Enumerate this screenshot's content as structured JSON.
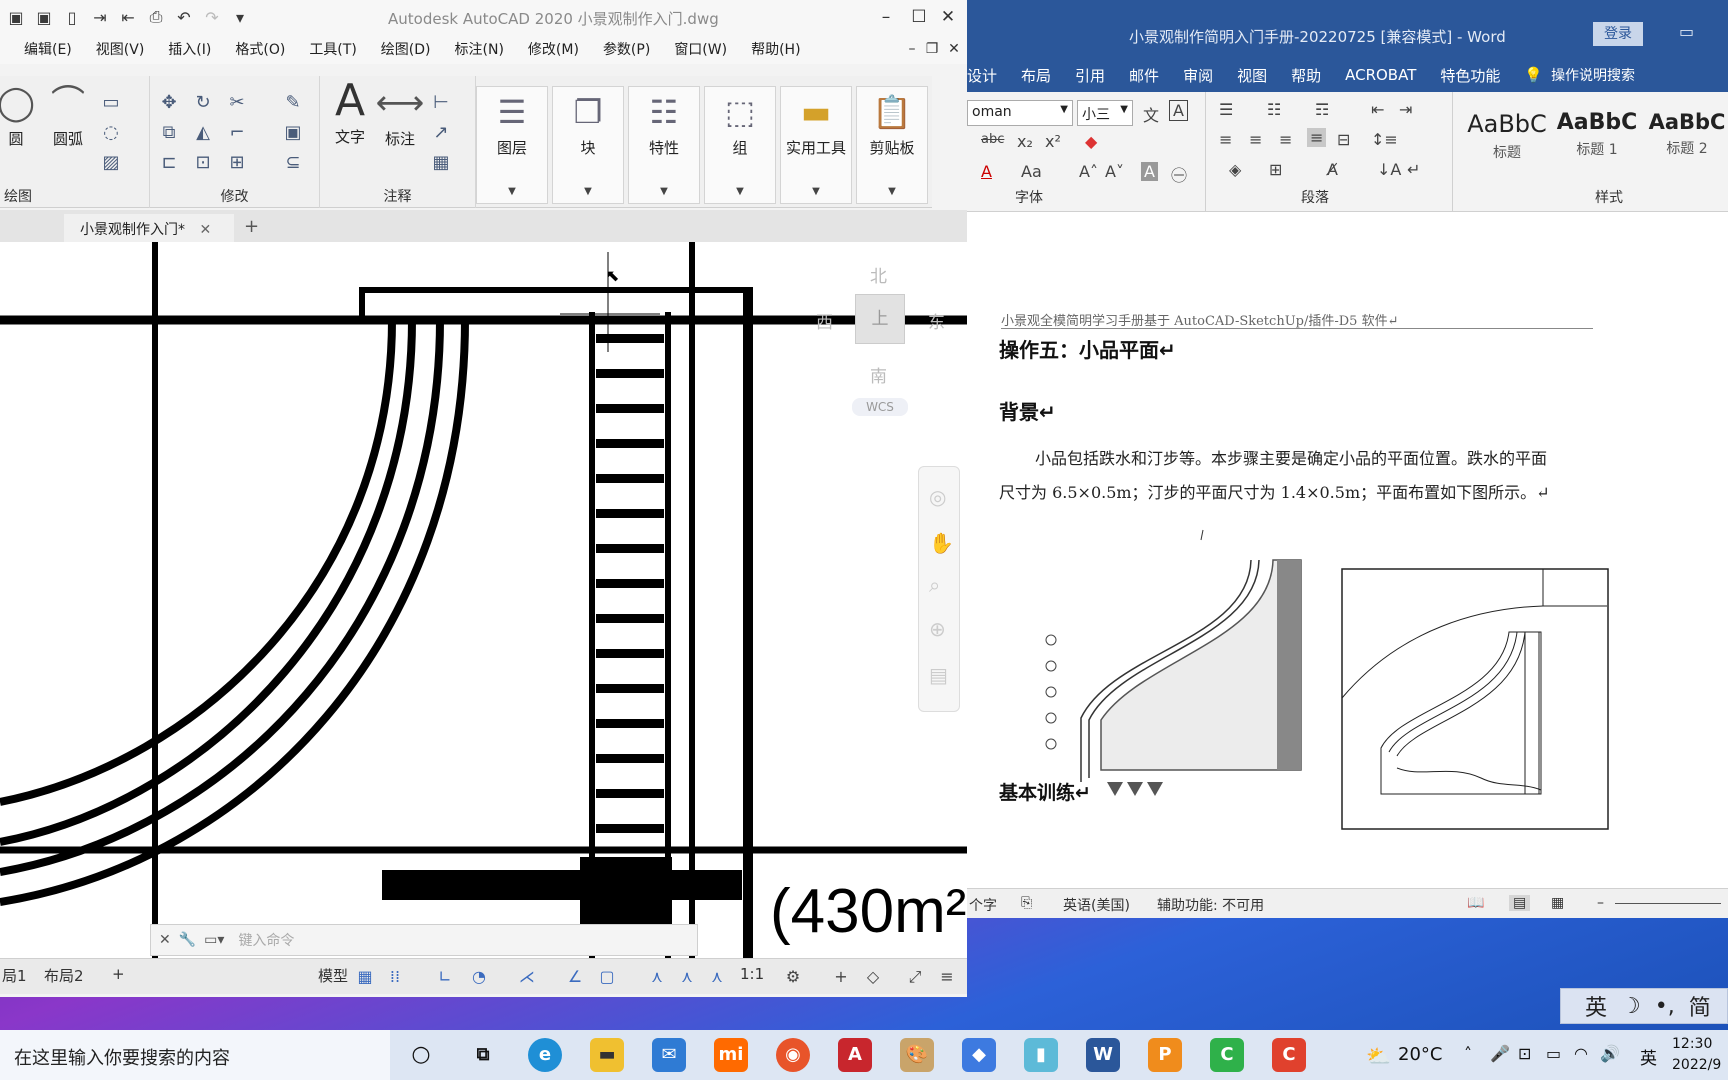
{
  "acad": {
    "title": "Autodesk AutoCAD 2020    小景观制作入门.dwg",
    "menu": [
      "编辑(E)",
      "视图(V)",
      "插入(I)",
      "格式(O)",
      "工具(T)",
      "绘图(D)",
      "标注(N)",
      "修改(M)",
      "参数(P)",
      "窗口(W)",
      "帮助(H)"
    ],
    "draw_group": {
      "circle": "圆",
      "arc": "圆弧",
      "label": "绘图"
    },
    "modify_group": {
      "label": "修改"
    },
    "annot_group": {
      "text": "文字",
      "dim": "标注",
      "label": "注释"
    },
    "panels": [
      "图层",
      "块",
      "特性",
      "组",
      "实用工具",
      "剪贴板"
    ],
    "doc_tab": "小景观制作入门*",
    "viewcube": {
      "north": "北",
      "south": "南",
      "east": "东",
      "west": "西",
      "top": "上",
      "wcs": "WCS"
    },
    "area_label": "(430m²",
    "command_placeholder": "键入命令",
    "layout_tabs": [
      "局1",
      "布局2"
    ],
    "status": {
      "model": "模型",
      "scale": "1:1"
    }
  },
  "word": {
    "title": "小景观制作简明入门手册-20220725 [兼容模式]  -  Word",
    "login": "登录",
    "tabs": [
      "设计",
      "布局",
      "引用",
      "邮件",
      "审阅",
      "视图",
      "帮助",
      "ACROBAT",
      "特色功能"
    ],
    "tell_me": "操作说明搜索",
    "font_name": "oman",
    "font_size": "小三",
    "groups": {
      "font": "字体",
      "paragraph": "段落",
      "styles": "样式"
    },
    "styles": [
      {
        "preview": "AaBbC",
        "name": "标题"
      },
      {
        "preview": "AaBbC",
        "name": "标题 1"
      },
      {
        "preview": "AaBbC",
        "name": "标题 2"
      }
    ],
    "page": {
      "header": "小景观全模简明学习手册基于 AutoCAD-SketchUp/插件-D5 软件↵",
      "heading_op": "操作五：小品平面↵",
      "heading_bg": "背景↵",
      "para1": "小品包括跌水和汀步等。本步骤主要是确定小品的平面位置。跌水的平面",
      "para2": "尺寸为 6.5×0.5m；汀步的平面尺寸为 1.4×0.5m；平面布置如下图所示。↵",
      "heading_train": "基本训练↵"
    },
    "status": {
      "words": "个字",
      "lang": "英语(美国)",
      "access": "辅助功能: 不可用"
    }
  },
  "taskbar": {
    "search": "在这里输入你要搜索的内容",
    "weather": "20°C",
    "ime_lang": "英",
    "time": "12:30",
    "date": "2022/9",
    "ime_bar": [
      "英",
      "☽",
      "•,",
      "简"
    ]
  }
}
